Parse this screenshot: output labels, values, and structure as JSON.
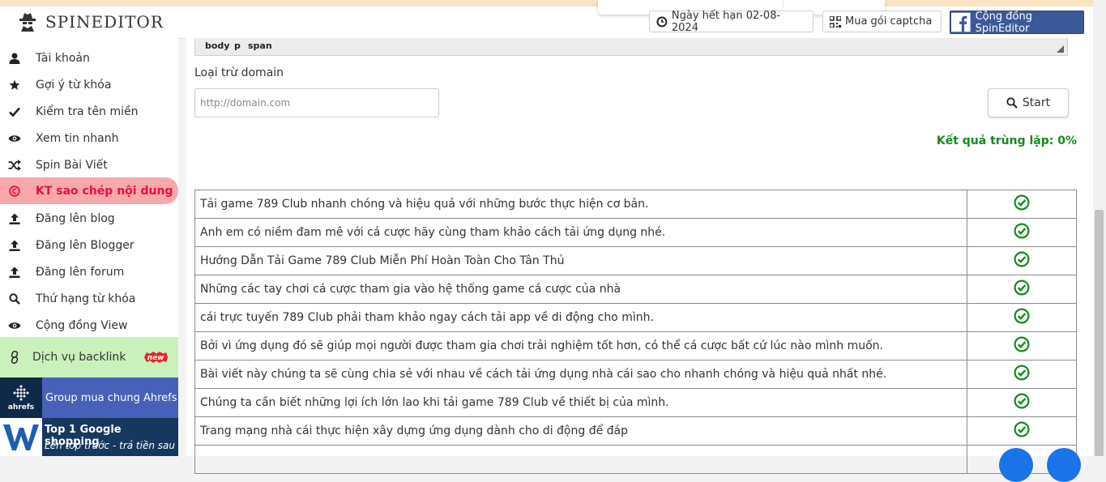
{
  "app": {
    "name": "SPINEDITOR"
  },
  "header": {
    "expiry_label": "Ngày hết hạn 02-08-2024",
    "captcha_label": "Mua gói captcha",
    "community_label": "Cộng đồng SpinEditor"
  },
  "sidebar": {
    "items": [
      {
        "label": "Tài khoản",
        "icon": "user-icon"
      },
      {
        "label": "Gợi ý từ khóa",
        "icon": "star-icon"
      },
      {
        "label": "Kiểm tra tên miền",
        "icon": "check-icon"
      },
      {
        "label": "Xem tin nhanh",
        "icon": "eye-icon"
      },
      {
        "label": "Spin Bài Viết",
        "icon": "shuffle-icon"
      },
      {
        "label": "KT sao chép nội dung",
        "icon": "copyright-icon",
        "active": true
      },
      {
        "label": "Đăng lên blog",
        "icon": "upload-icon"
      },
      {
        "label": "Đăng lên Blogger",
        "icon": "upload-icon"
      },
      {
        "label": "Đăng lên forum",
        "icon": "upload-icon"
      },
      {
        "label": "Thứ hạng từ khóa",
        "icon": "search-icon"
      },
      {
        "label": "Cộng đồng View",
        "icon": "eye-icon"
      }
    ],
    "backlink": {
      "label": "Dịch vụ backlink",
      "badge": "new"
    },
    "ahrefs": {
      "logo_text": "ahrefs",
      "label": "Group mua chung Ahrefs"
    },
    "google": {
      "line1": "Top 1 Google shopping",
      "line2": "Lên top trước - trả tiền sau"
    }
  },
  "editor": {
    "path": [
      "body",
      "p",
      "span"
    ]
  },
  "form": {
    "exclude_label": "Loại trừ domain",
    "domain_placeholder": "http://domain.com",
    "start_label": "Start"
  },
  "result": {
    "label": "Kết quả trùng lặp: 0%"
  },
  "rows": [
    "Tải game 789 Club nhanh chóng và hiệu quả với những bước thực hiện cơ bản.",
    "Anh em có niềm đam mê với cá cược hãy cùng tham khảo cách tải ứng dụng nhé.",
    "Hướng Dẫn Tải Game 789 Club Miễn Phí Hoàn Toàn Cho Tân Thủ",
    "Những các tay chơi cá cược tham gia vào hệ thống game cá cược của nhà",
    "cái trực tuyến 789 Club phải tham khảo ngay cách tải app về di động cho mình.",
    "Bởi vì ứng dụng đó sẽ giúp mọi người được tham gia chơi trải nghiệm tốt hơn, có thể cá cược bất cứ lúc nào mình muốn.",
    "Bài viết này chúng ta sẽ cùng chia sẻ với nhau về cách tải ứng dụng nhà cái sao cho nhanh chóng và hiệu quả nhất nhé.",
    "Chúng ta cần biết những lợi ích lớn lao khi tải game 789 Club về thiết bị của mình.",
    "Trang mạng nhà cái thực hiện xây dựng ứng dụng dành cho di động để đáp"
  ],
  "colors": {
    "accent_green": "#138a1f",
    "active_bg": "#f7a8a8",
    "active_text": "#e8113a",
    "facebook": "#3b5998"
  }
}
